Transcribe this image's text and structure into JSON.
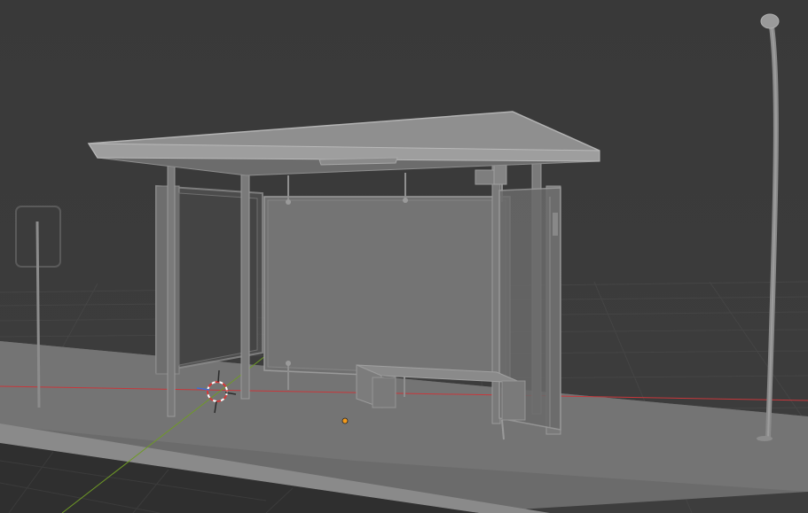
{
  "viewport": {
    "mode": "3d-viewport",
    "shading": "x-ray",
    "background_color": "#3a3a3a",
    "grid_color": "#454545",
    "x_axis_color": "#c8373b",
    "y_axis_color": "#6f9a26",
    "origin_color": "#f39a1b"
  },
  "scene": {
    "objects": [
      "bus-shelter",
      "bus-stop-sign",
      "street-lamp",
      "sidewalk-curb",
      "3d-cursor",
      "object-origin"
    ]
  }
}
